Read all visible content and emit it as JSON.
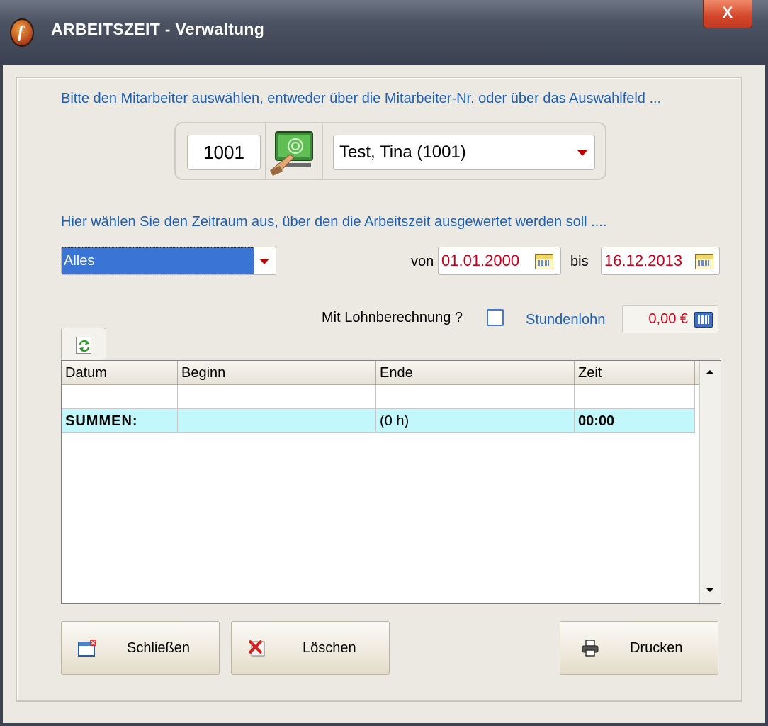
{
  "window": {
    "title": "ARBEITSZEIT - Verwaltung",
    "close_symbol": "X",
    "app_icon_letter": "f"
  },
  "employee": {
    "instruction": "Bitte den Mitarbeiter auswählen, entweder über die Mitarbeiter-Nr. oder über das Auswahlfeld ...",
    "number": "1001",
    "selected_name": "Test, Tina (1001)"
  },
  "period": {
    "instruction": "Hier wählen Sie den Zeitraum aus, über den die Arbeitszeit  ausgewertet werden soll ....",
    "selected": "Alles",
    "from_label": "von",
    "from_date": "01.01.2000",
    "to_label": "bis",
    "to_date": "16.12.2013"
  },
  "wage": {
    "checkbox_label": "Mit Lohnberechnung ?",
    "checked": false,
    "hourly_label": "Stundenlohn",
    "hourly_value": "0,00 €"
  },
  "grid": {
    "columns": [
      "Datum",
      "Beginn",
      "Ende",
      "Zeit"
    ],
    "rows": [
      [
        "",
        "",
        "",
        ""
      ]
    ],
    "summary": [
      "SUMMEN:",
      "",
      "(0 h)",
      "00:00"
    ]
  },
  "buttons": {
    "close": "Schließen",
    "delete": "Löschen",
    "print": "Drucken"
  },
  "colors": {
    "accent_label": "#1f5fb0",
    "date_text": "#c8001a",
    "summary_row": "#c2f7fb",
    "selection": "#3a74d4"
  }
}
